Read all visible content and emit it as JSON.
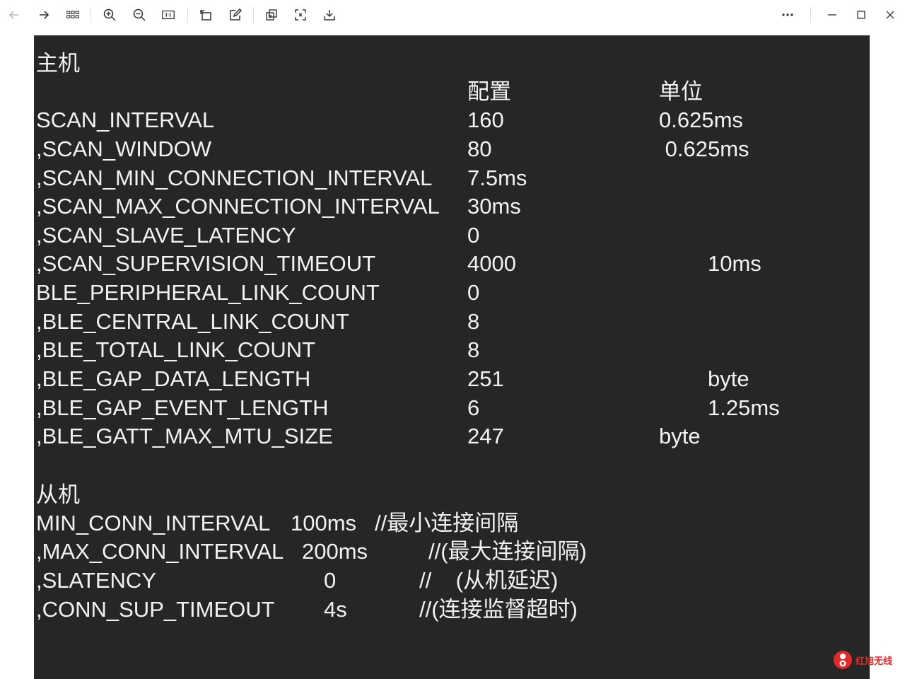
{
  "toolbar": {
    "icons": [
      "back-arrow-icon",
      "forward-arrow-icon",
      "grid-icon",
      "zoom-in-icon",
      "zoom-out-icon",
      "actual-size-icon",
      "rotate-icon",
      "edit-icon",
      "crop-icon",
      "fit-screen-icon",
      "save-icon",
      "more-icon",
      "minimize-icon",
      "maximize-icon",
      "close-icon"
    ]
  },
  "doc": {
    "master_heading": "主机",
    "col_config": "配置",
    "col_unit": "单位",
    "rows": [
      {
        "name": "SCAN_INTERVAL",
        "value": "160",
        "unit": "0.625ms"
      },
      {
        "name": ",SCAN_WINDOW",
        "value": "80",
        "unit": " 0.625ms"
      },
      {
        "name": ",SCAN_MIN_CONNECTION_INTERVAL",
        "value": "7.5ms",
        "unit": ""
      },
      {
        "name": ",SCAN_MAX_CONNECTION_INTERVAL",
        "value": "30ms",
        "unit": ""
      },
      {
        "name": ",SCAN_SLAVE_LATENCY",
        "value": "0",
        "unit": ""
      },
      {
        "name": ",SCAN_SUPERVISION_TIMEOUT",
        "value": "4000",
        "unit": "10ms"
      },
      {
        "name": "BLE_PERIPHERAL_LINK_COUNT",
        "value": "0",
        "unit": ""
      },
      {
        "name": ",BLE_CENTRAL_LINK_COUNT",
        "value": "8",
        "unit": ""
      },
      {
        "name": ",BLE_TOTAL_LINK_COUNT",
        "value": "8",
        "unit": ""
      },
      {
        "name": ",BLE_GAP_DATA_LENGTH",
        "value": "251",
        "unit": "byte"
      },
      {
        "name": ",BLE_GAP_EVENT_LENGTH",
        "value": "6",
        "unit": "1.25ms"
      },
      {
        "name": ",BLE_GATT_MAX_MTU_SIZE",
        "value": "247",
        "unit": "byte"
      }
    ],
    "slave_heading": "从机",
    "slave_rows": [
      {
        "name": "MIN_CONN_INTERVAL",
        "value": "100ms",
        "comment": "//最小连接间隔"
      },
      {
        "name": ",MAX_CONN_INTERVAL",
        "value": "200ms",
        "comment": "//(最大连接间隔)"
      },
      {
        "name": ",SLATENCY",
        "value": "0",
        "comment": "//    (从机延迟)"
      },
      {
        "name": ",CONN_SUP_TIMEOUT",
        "value": "4s",
        "comment": "//(连接监督超时)"
      }
    ]
  },
  "watermark": {
    "text": "红旭无线",
    "logo_color": "#e02a2a"
  }
}
